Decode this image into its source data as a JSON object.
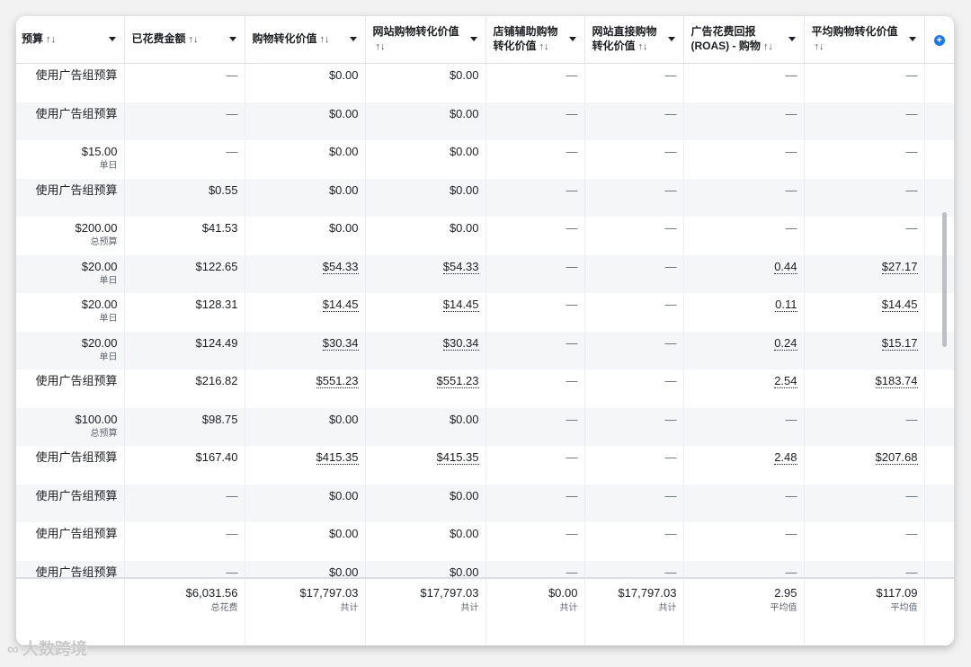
{
  "header": {
    "columns": [
      {
        "label": "预算",
        "sort": "↑↓"
      },
      {
        "label": "已花费金额",
        "sort": "↑↓"
      },
      {
        "label": "购物转化价值",
        "sort": "↑↓"
      },
      {
        "label": "网站购物转化价值",
        "sort": "↑↓"
      },
      {
        "label": "店铺辅助购物转化价值",
        "sort": "↑↓"
      },
      {
        "label": "网站直接购物转化价值",
        "sort": "↑↓"
      },
      {
        "label": "广告花费回报 (ROAS) - 购物",
        "sort": "↑↓"
      },
      {
        "label": "平均购物转化价值",
        "sort": "↑↓"
      }
    ],
    "add_column_symbol": "+"
  },
  "rows": [
    {
      "budget": "使用广告组预算",
      "budget_sub": "",
      "spent": "—",
      "purchase": "$0.00",
      "web": "$0.00",
      "store": "—",
      "direct": "—",
      "roas": "—",
      "avg": "—"
    },
    {
      "budget": "使用广告组预算",
      "budget_sub": "",
      "spent": "—",
      "purchase": "$0.00",
      "web": "$0.00",
      "store": "—",
      "direct": "—",
      "roas": "—",
      "avg": "—"
    },
    {
      "budget": "$15.00",
      "budget_sub": "单日",
      "spent": "—",
      "purchase": "$0.00",
      "web": "$0.00",
      "store": "—",
      "direct": "—",
      "roas": "—",
      "avg": "—"
    },
    {
      "budget": "使用广告组预算",
      "budget_sub": "",
      "spent": "$0.55",
      "purchase": "$0.00",
      "web": "$0.00",
      "store": "—",
      "direct": "—",
      "roas": "—",
      "avg": "—"
    },
    {
      "budget": "$200.00",
      "budget_sub": "总预算",
      "spent": "$41.53",
      "purchase": "$0.00",
      "web": "$0.00",
      "store": "—",
      "direct": "—",
      "roas": "—",
      "avg": "—"
    },
    {
      "budget": "$20.00",
      "budget_sub": "单日",
      "spent": "$122.65",
      "purchase": "$54.33",
      "web": "$54.33",
      "store": "—",
      "direct": "—",
      "roas": "0.44",
      "avg": "$27.17"
    },
    {
      "budget": "$20.00",
      "budget_sub": "单日",
      "spent": "$128.31",
      "purchase": "$14.45",
      "web": "$14.45",
      "store": "—",
      "direct": "—",
      "roas": "0.11",
      "avg": "$14.45"
    },
    {
      "budget": "$20.00",
      "budget_sub": "单日",
      "spent": "$124.49",
      "purchase": "$30.34",
      "web": "$30.34",
      "store": "—",
      "direct": "—",
      "roas": "0.24",
      "avg": "$15.17"
    },
    {
      "budget": "使用广告组预算",
      "budget_sub": "",
      "spent": "$216.82",
      "purchase": "$551.23",
      "web": "$551.23",
      "store": "—",
      "direct": "—",
      "roas": "2.54",
      "avg": "$183.74"
    },
    {
      "budget": "$100.00",
      "budget_sub": "总预算",
      "spent": "$98.75",
      "purchase": "$0.00",
      "web": "$0.00",
      "store": "—",
      "direct": "—",
      "roas": "—",
      "avg": "—"
    },
    {
      "budget": "使用广告组预算",
      "budget_sub": "",
      "spent": "$167.40",
      "purchase": "$415.35",
      "web": "$415.35",
      "store": "—",
      "direct": "—",
      "roas": "2.48",
      "avg": "$207.68"
    },
    {
      "budget": "使用广告组预算",
      "budget_sub": "",
      "spent": "—",
      "purchase": "$0.00",
      "web": "$0.00",
      "store": "—",
      "direct": "—",
      "roas": "—",
      "avg": "—"
    },
    {
      "budget": "使用广告组预算",
      "budget_sub": "",
      "spent": "—",
      "purchase": "$0.00",
      "web": "$0.00",
      "store": "—",
      "direct": "—",
      "roas": "—",
      "avg": "—"
    },
    {
      "budget": "使用广告组预算",
      "budget_sub": "",
      "spent": "—",
      "purchase": "$0.00",
      "web": "$0.00",
      "store": "—",
      "direct": "—",
      "roas": "—",
      "avg": "—"
    }
  ],
  "totals": {
    "spent": "$6,031.56",
    "spent_sub": "总花费",
    "purchase": "$17,797.03",
    "purchase_sub": "共计",
    "web": "$17,797.03",
    "web_sub": "共计",
    "store": "$0.00",
    "store_sub": "共计",
    "direct": "$17,797.03",
    "direct_sub": "共计",
    "roas": "2.95",
    "roas_sub": "平均值",
    "avg": "$117.09",
    "avg_sub": "平均值"
  },
  "watermark": {
    "icon": "∞",
    "text": "大数跨境"
  },
  "colors": {
    "accent": "#1877f2",
    "text": "#1c1e21",
    "muted": "#606770",
    "stripe": "#f5f6f7"
  }
}
